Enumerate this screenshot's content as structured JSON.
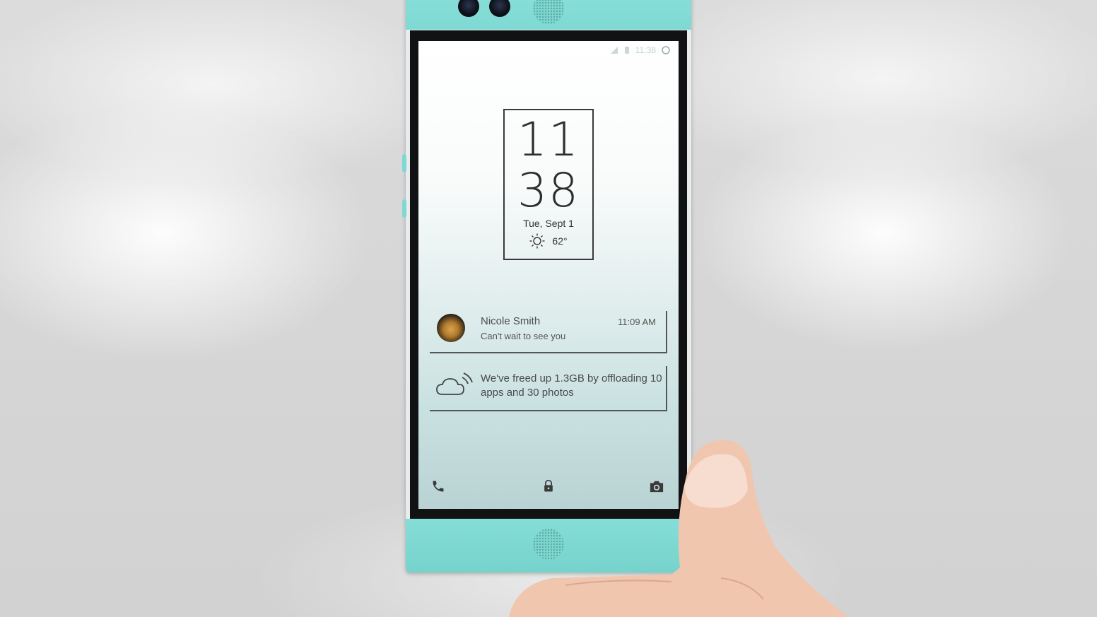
{
  "status_bar": {
    "time": "11:38"
  },
  "lock_screen": {
    "clock_hour": "11",
    "clock_minute": "38",
    "date": "Tue, Sept 1",
    "temperature": "62°",
    "weather_icon": "sun-icon"
  },
  "notifications": [
    {
      "type": "message",
      "sender": "Nicole Smith",
      "message": "Can't wait to see you",
      "time": "11:09 AM",
      "icon": "avatar"
    },
    {
      "type": "system",
      "text": "We've freed up 1.3GB by offloading 10 apps and 30 photos",
      "icon": "cloud-sync-icon"
    }
  ],
  "dock": [
    {
      "icon": "phone-icon"
    },
    {
      "icon": "lock-icon"
    },
    {
      "icon": "camera-icon"
    }
  ],
  "colors": {
    "device_accent": "#7fd9d3",
    "text_dark": "#2d2d2d"
  }
}
